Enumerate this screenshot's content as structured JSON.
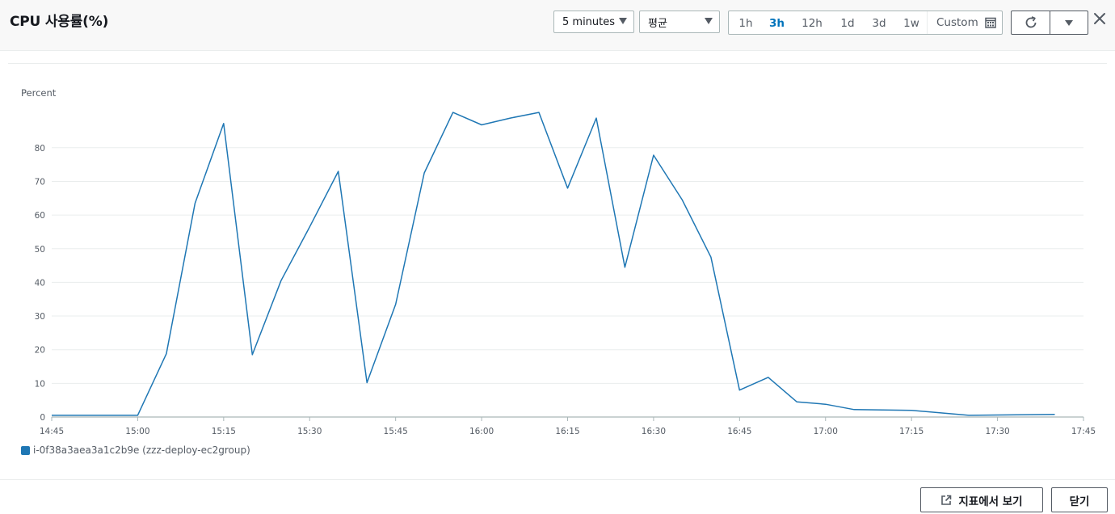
{
  "header": {
    "title": "CPU 사용률(%)",
    "period_select": "5 minutes",
    "stat_select": "평균",
    "ranges": [
      "1h",
      "3h",
      "12h",
      "1d",
      "3d",
      "1w"
    ],
    "active_range": "3h",
    "custom_label": "Custom"
  },
  "footer": {
    "view_in_metrics_label": "지표에서 보기",
    "close_label": "닫기"
  },
  "colors": {
    "series": "#1f77b4",
    "active": "#0073bb"
  },
  "chart_data": {
    "type": "line",
    "ylabel": "Percent",
    "ylim": [
      0,
      90
    ],
    "yticks": [
      0,
      10,
      20,
      30,
      40,
      50,
      60,
      70,
      80
    ],
    "xticks": [
      "14:45",
      "15:00",
      "15:15",
      "15:30",
      "15:45",
      "16:00",
      "16:15",
      "16:30",
      "16:45",
      "17:00",
      "17:15",
      "17:30",
      "17:45"
    ],
    "grid": true,
    "legend_position": "bottom-left",
    "series": [
      {
        "name": "i-0f38a3aea3a1c2b9e (zzz-deploy-ec2group)",
        "x": [
          "14:45",
          "15:00",
          "15:05",
          "15:10",
          "15:15",
          "15:20",
          "15:25",
          "15:30",
          "15:35",
          "15:40",
          "15:45",
          "15:50",
          "15:55",
          "16:00",
          "16:05",
          "16:10",
          "16:15",
          "16:20",
          "16:25",
          "16:30",
          "16:35",
          "16:40",
          "16:45",
          "16:50",
          "16:55",
          "17:00",
          "17:05",
          "17:15",
          "17:25",
          "17:40"
        ],
        "values": [
          0.5,
          0.5,
          18.8,
          63.5,
          87.2,
          18.5,
          40.5,
          56.5,
          73.0,
          10.2,
          33.5,
          72.5,
          90.5,
          86.8,
          88.8,
          90.5,
          68.0,
          88.8,
          44.5,
          77.8,
          64.5,
          47.5,
          8.0,
          11.8,
          4.5,
          3.8,
          2.2,
          2.0,
          0.5,
          0.8
        ]
      }
    ]
  }
}
